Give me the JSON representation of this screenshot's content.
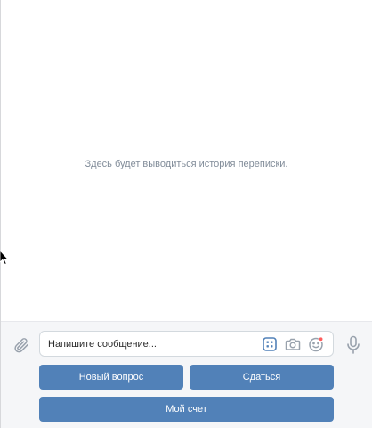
{
  "history": {
    "placeholder": "Здесь будет выводиться история переписки."
  },
  "composer": {
    "placeholder": "Напишите сообщение...",
    "value": ""
  },
  "icons": {
    "attach": "paperclip-icon",
    "keyboard": "bot-keyboard-icon",
    "camera": "camera-icon",
    "smile": "smile-icon",
    "mic": "microphone-icon"
  },
  "keyboard": {
    "buttons": [
      {
        "label": "Новый вопрос"
      },
      {
        "label": "Сдаться"
      },
      {
        "label": "Мой счет"
      }
    ]
  },
  "colors": {
    "accent": "#5181b8",
    "icon": "#99a2ad",
    "notification_dot": "#ff5c5c",
    "panel_bg": "#f5f6f8"
  }
}
